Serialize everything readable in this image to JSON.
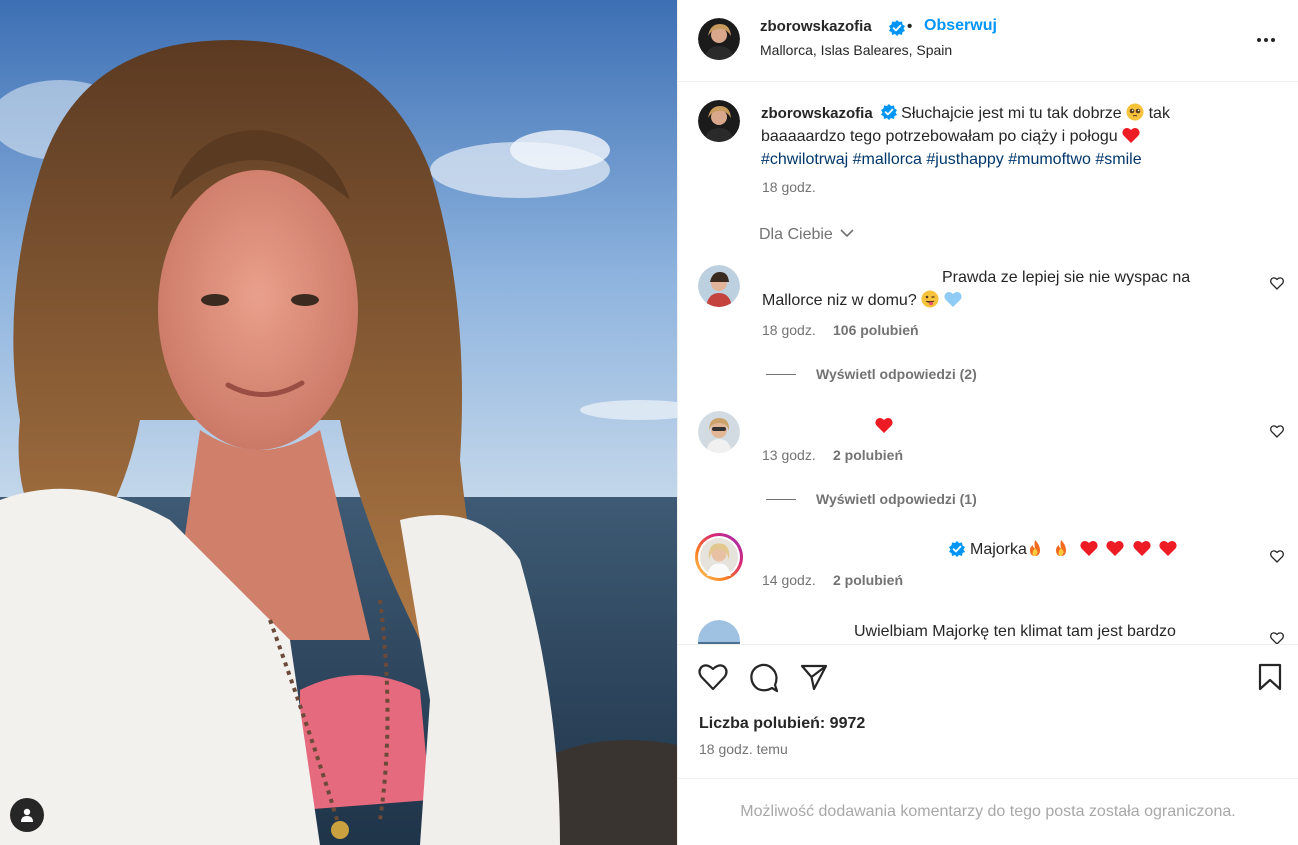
{
  "post": {
    "username": "zborowskazofia",
    "verified": true,
    "dot": "•",
    "follow_label": "Obserwuj",
    "location": "Mallorca, Islas Baleares, Spain",
    "caption_text_1": "Słuchajcie jest mi tu tak dobrze",
    "caption_text_2": "tak baaaaardzo tego potrzebowałam po ciąży i połogu",
    "hashtags": "#chwilotrwaj #mallorca #justhappy #mumoftwo #smile",
    "caption_time": "18 godz.",
    "filter_label": "Dla Ciebie"
  },
  "comments": [
    {
      "text_1": "Prawda ze lepiej sie nie wyspac na",
      "text_2": "Mallorce niz w domu?",
      "time": "18 godz.",
      "likes": "106 polubień",
      "replies": "Wyświetl odpowiedzi (2)"
    },
    {
      "time": "13 godz.",
      "likes": "2 polubień",
      "replies": "Wyświetl odpowiedzi (1)"
    },
    {
      "text": "Majorka",
      "time": "14 godz.",
      "likes": "2 polubień"
    },
    {
      "text": "Uwielbiam Majorkę ten klimat tam jest bardzo"
    }
  ],
  "engagement": {
    "likes_label": "Liczba polubień: 9972",
    "time_ago": "18 godz. temu",
    "comments_limited": "Możliwość dodawania komentarzy do tego posta została ograniczona."
  },
  "icons": [
    "user-tag-icon",
    "verified-icon",
    "more-icon",
    "heart-icon",
    "comment-icon",
    "share-icon",
    "bookmark-icon"
  ],
  "colors": {
    "link_blue": "#0095f6",
    "hashtag": "#00376b",
    "heart_red": "#ed1c24"
  }
}
